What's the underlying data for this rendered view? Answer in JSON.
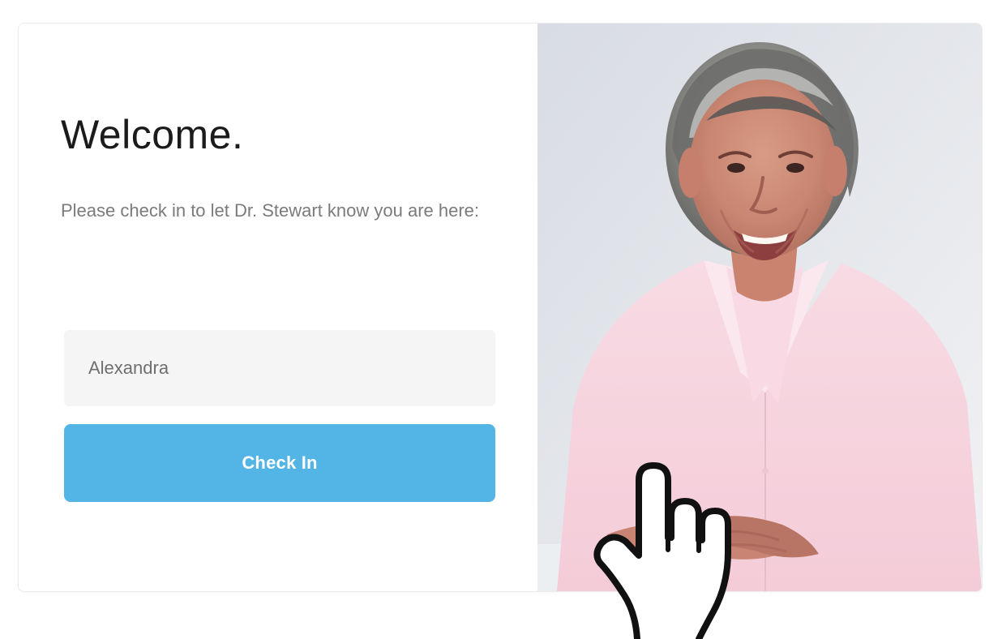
{
  "checkin": {
    "title": "Welcome.",
    "subtitle": "Please check in to let Dr. Stewart know you are here:",
    "name_value": "Alexandra",
    "button_label": "Check In"
  },
  "colors": {
    "button": "#53b4e6",
    "input_background": "#f5f5f5",
    "title_text": "#1b1b1b",
    "subtitle_text": "#7b7b7b"
  },
  "icons": {
    "cursor": "hand-pointer-icon"
  }
}
